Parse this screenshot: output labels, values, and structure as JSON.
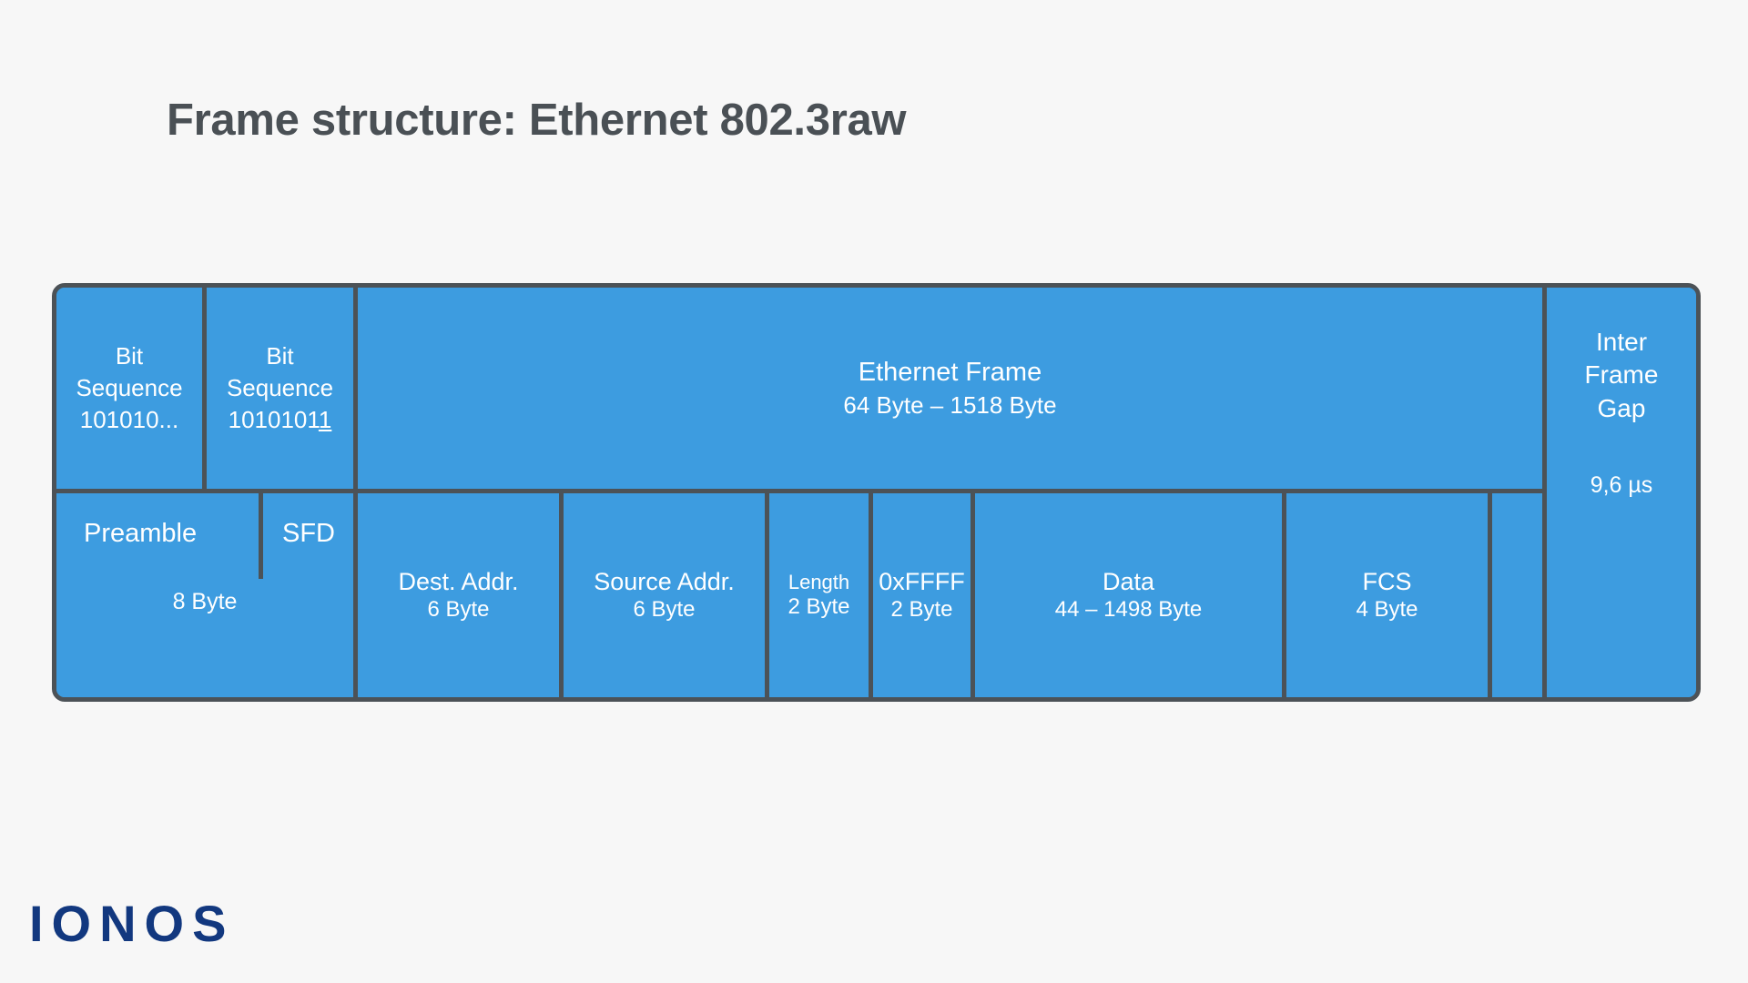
{
  "page": {
    "title": "Frame structure: Ethernet 802.3raw",
    "background_color": "#f7f7f7",
    "accent_color": "#3d9ce0",
    "border_color": "#4c5257",
    "title_color": "#4a5055",
    "logo_color": "#12387f"
  },
  "logo": {
    "text": "IONOS"
  },
  "diagram": {
    "top_row": [
      {
        "id": "preamble-bits",
        "label_line1": "Bit",
        "label_line2": "Sequence",
        "label_line3": "101010..."
      },
      {
        "id": "sfd-bits",
        "label_line1": "Bit",
        "label_line2": "Sequence",
        "label_line3": "1010101",
        "label_line3_underlined": "1"
      },
      {
        "id": "ethernet-frame",
        "label": "Ethernet Frame",
        "sublabel": "64 Byte – 1518 Byte"
      }
    ],
    "bottom_row": [
      {
        "id": "preamble",
        "label": "Preamble",
        "label2": "SFD",
        "sublabel": "8 Byte"
      },
      {
        "id": "dest-addr",
        "label": "Dest. Addr.",
        "sublabel": "6 Byte"
      },
      {
        "id": "source-addr",
        "label": "Source Addr.",
        "sublabel": "6 Byte"
      },
      {
        "id": "length",
        "label": "Length",
        "sublabel": "2 Byte"
      },
      {
        "id": "type",
        "label": "0xFFFF",
        "sublabel": "2 Byte"
      },
      {
        "id": "data",
        "label": "Data",
        "sublabel": "44 – 1498 Byte"
      },
      {
        "id": "fcs",
        "label": "FCS",
        "sublabel": "4 Byte"
      }
    ],
    "trailer": {
      "id": "inter-frame-gap",
      "label_line1": "Inter",
      "label_line2": "Frame",
      "label_line3": "Gap",
      "sublabel": "9,6 µs"
    }
  }
}
